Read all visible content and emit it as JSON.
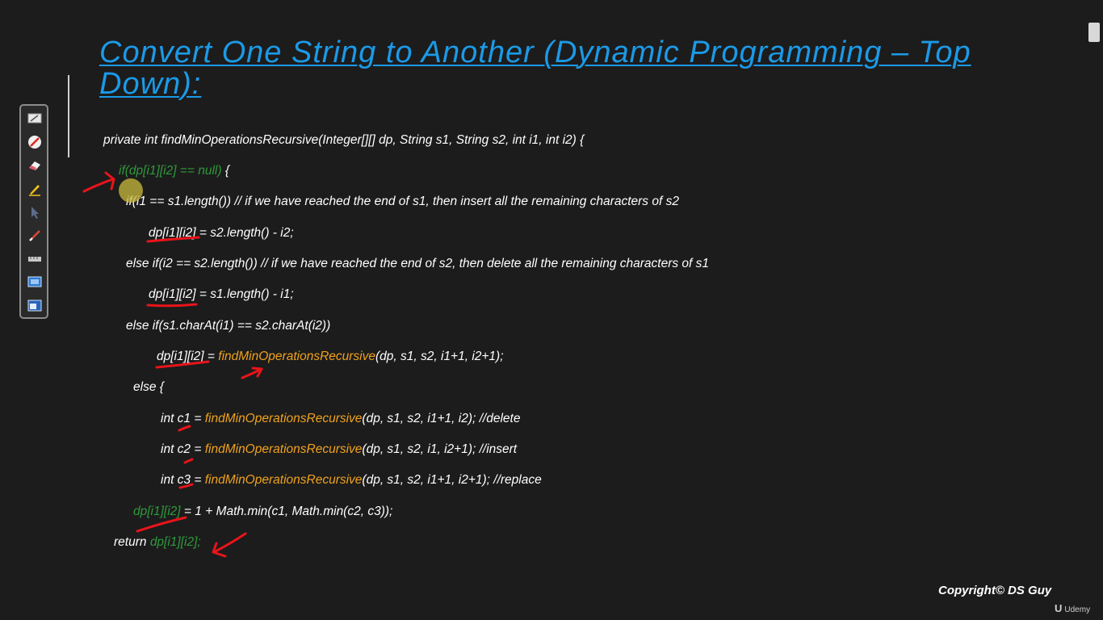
{
  "title": "Convert One String to Another (Dynamic Programming – Top Down):",
  "code": {
    "line1": "private int findMinOperationsRecursive(Integer[][] dp, String s1, String s2, int i1, int i2) {",
    "line2_cond": "if(dp[i1][i2] == null)",
    "line2_rest": " {",
    "line3": "if(i1 == s1.length()) // if we have reached the end of s1, then insert all the remaining characters of s2",
    "line4_var": "dp[i1][i2]",
    "line4_rest": " = s2.length() - i2;",
    "line5": "else if(i2 == s2.length()) // if we have reached the end of s2, then delete all the remaining characters of s1",
    "line6_var": "dp[i1][i2]",
    "line6_rest": " = s1.length() - i1;",
    "line7": "else if(s1.charAt(i1) == s2.charAt(i2))",
    "line8_var": "dp[i1][i2]",
    "line8_eq": " = ",
    "line8_call": "findMinOperationsRecursive",
    "line8_args": "(dp, s1, s2, i1+1, i2+1);",
    "line9": "else {",
    "line10_pre": "int c1 = ",
    "line10_call": "findMinOperationsRecursive",
    "line10_args": "(dp, s1, s2, i1+1, i2); //delete",
    "line11_pre": "int c2 = ",
    "line11_call": "findMinOperationsRecursive",
    "line11_args": "(dp, s1, s2, i1, i2+1); //insert",
    "line12_pre": "int c3 = ",
    "line12_call": "findMinOperationsRecursive",
    "line12_args": "(dp, s1, s2, i1+1, i2+1); //replace",
    "line13_var": "dp[i1][i2]",
    "line13_rest": " = 1 + Math.min(c1, Math.min(c2, c3));",
    "line14_kw": "return ",
    "line14_var": "dp[i1][i2];"
  },
  "footer": {
    "copyright": "Copyright© DS Guy",
    "brand_mark": "U",
    "brand": "Udemy"
  },
  "toolbar": {
    "tools": [
      "whiteboard-icon",
      "no-entry-icon",
      "eraser-icon",
      "highlighter-icon",
      "pointer-icon",
      "pen-icon",
      "ruler-icon",
      "screen-capture-icon",
      "window-capture-icon"
    ]
  },
  "colors": {
    "background": "#1c1c1c",
    "title": "#1b9ae8",
    "code_text": "#ffffff",
    "green": "#2e9a3c",
    "orange": "#f0a21e",
    "annotation_red": "#e8141a"
  }
}
